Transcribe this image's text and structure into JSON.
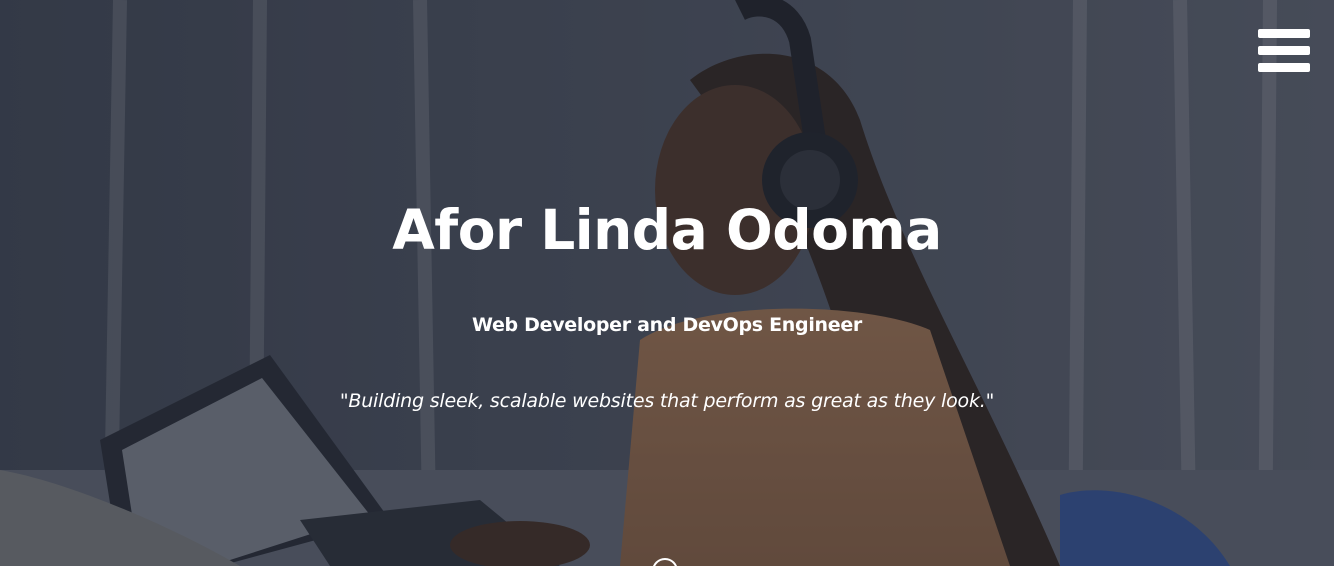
{
  "hero": {
    "name": "Afor Linda Odoma",
    "role": "Web Developer and DevOps Engineer",
    "quote": "\"Building sleek, scalable websites that perform as great as they look.\""
  },
  "nav": {
    "menu_icon": "hamburger-menu-icon"
  },
  "scroll": {
    "icon": "scroll-down-icon"
  },
  "colors": {
    "text": "#ffffff",
    "overlay": "#191e2d"
  }
}
